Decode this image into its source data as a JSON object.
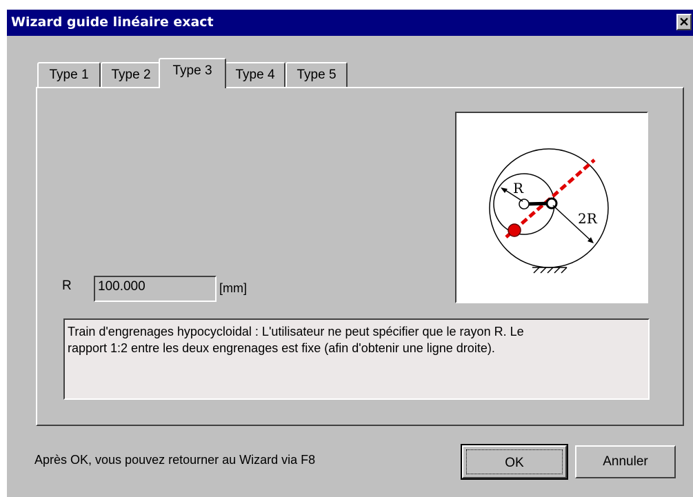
{
  "window": {
    "title": "Wizard guide linéaire exact",
    "close_glyph": "✕"
  },
  "tabs": [
    {
      "label": "Type 1",
      "active": false
    },
    {
      "label": "Type 2",
      "active": false
    },
    {
      "label": "Type 3",
      "active": true
    },
    {
      "label": "Type 4",
      "active": false
    },
    {
      "label": "Type 5",
      "active": false
    }
  ],
  "diagram": {
    "label_r": "R",
    "label_2r": "2R",
    "colors": {
      "path": "#e00000",
      "point": "#e00000"
    }
  },
  "form": {
    "r_label": "R",
    "r_value": "100.000",
    "unit": "[mm]"
  },
  "description": {
    "line1": "Train d'engrenages hypocycloidal : L'utilisateur ne peut spécifier que le rayon R. Le",
    "line2": "rapport 1:2 entre les deux engrenages est fixe (afin d'obtenir une ligne droite)."
  },
  "footer": {
    "note": "Après OK, vous pouvez retourner au Wizard via F8",
    "ok_label": "OK",
    "cancel_label": "Annuler"
  }
}
